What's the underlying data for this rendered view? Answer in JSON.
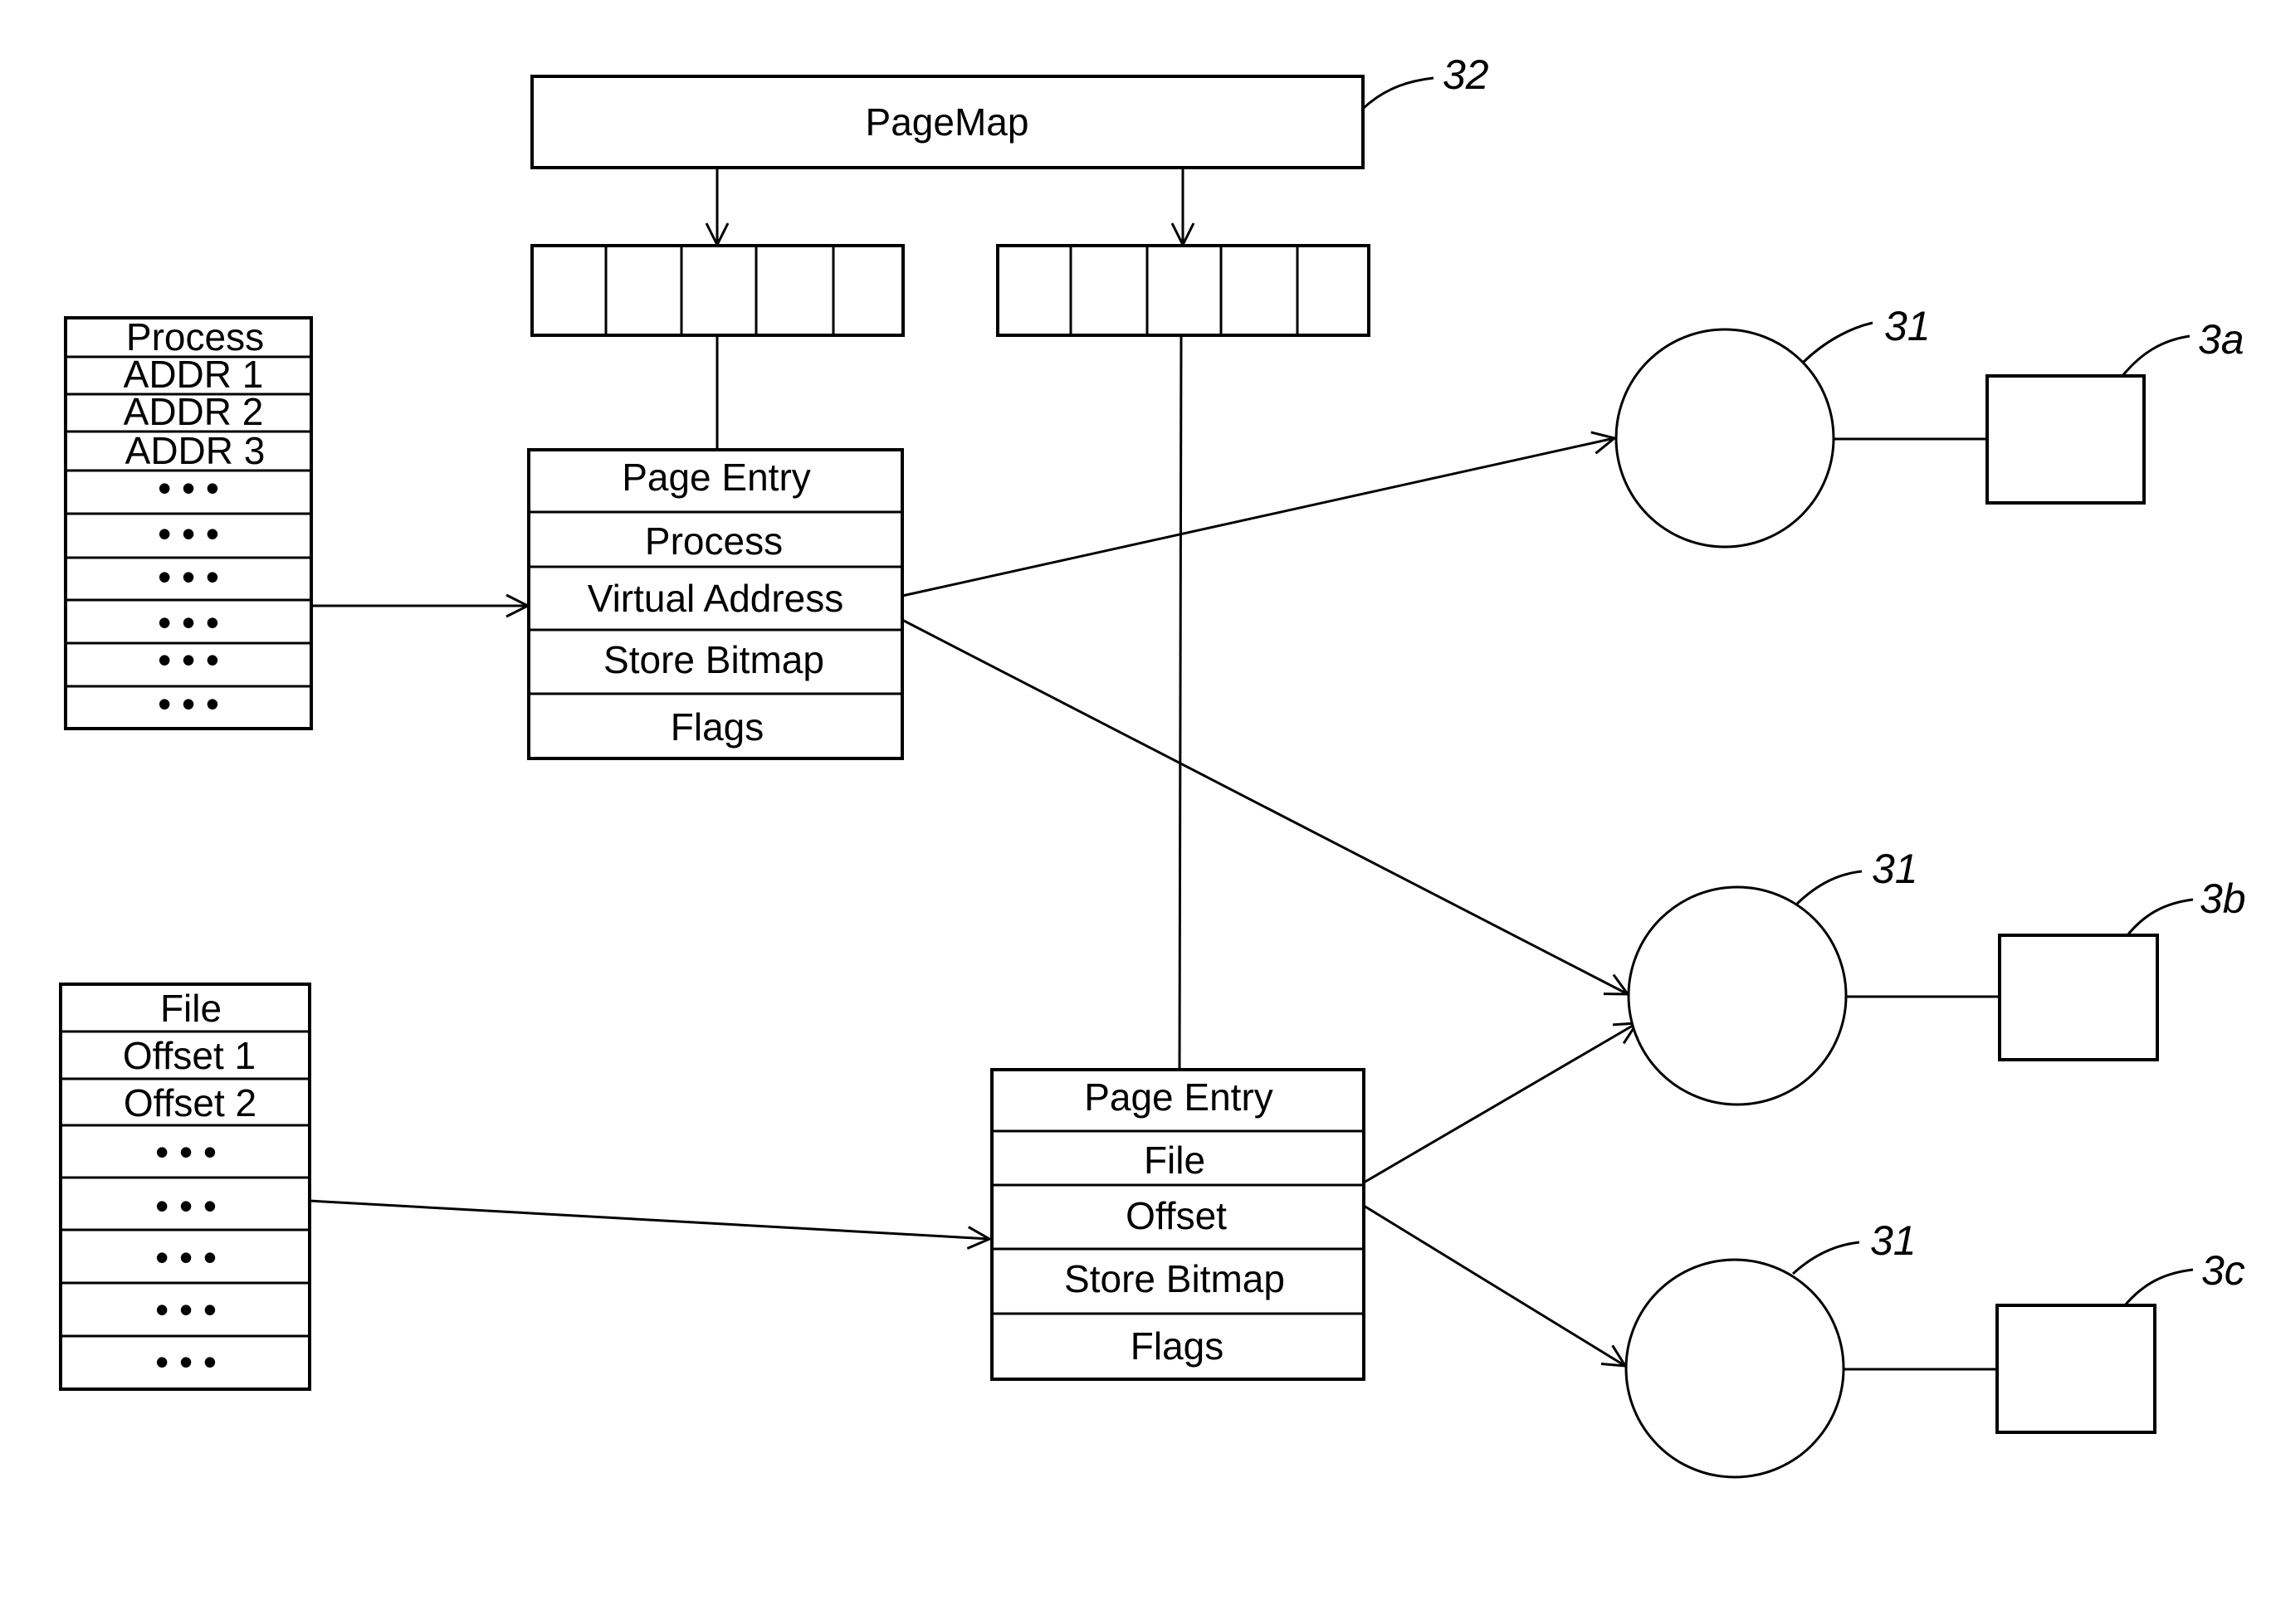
{
  "diagram": {
    "pagemap": {
      "label": "PageMap",
      "ref": "32"
    },
    "process_table": {
      "header": "Process",
      "rows": [
        "ADDR 1",
        "ADDR 2",
        "ADDR 3",
        "• • •",
        "• • •",
        "• • •",
        "• • •",
        "• • •",
        "• • •"
      ]
    },
    "file_table": {
      "header": "File",
      "rows": [
        "Offset 1",
        "Offset 2",
        "• • •",
        "• • •",
        "• • •",
        "• • •",
        "• • •"
      ]
    },
    "process_page_entry": {
      "fields": [
        "Page Entry",
        "Process",
        "Virtual Address",
        "Store Bitmap",
        "Flags"
      ]
    },
    "file_page_entry": {
      "fields": [
        "Page Entry",
        "File",
        "Offset",
        "Store Bitmap",
        "Flags"
      ]
    },
    "stores": [
      {
        "ref": "31",
        "device_ref": "3a"
      },
      {
        "ref": "31",
        "device_ref": "3b"
      },
      {
        "ref": "31",
        "device_ref": "3c"
      }
    ],
    "array_cells": 5,
    "colors": {
      "stroke": "#000000",
      "background": "#ffffff"
    }
  }
}
